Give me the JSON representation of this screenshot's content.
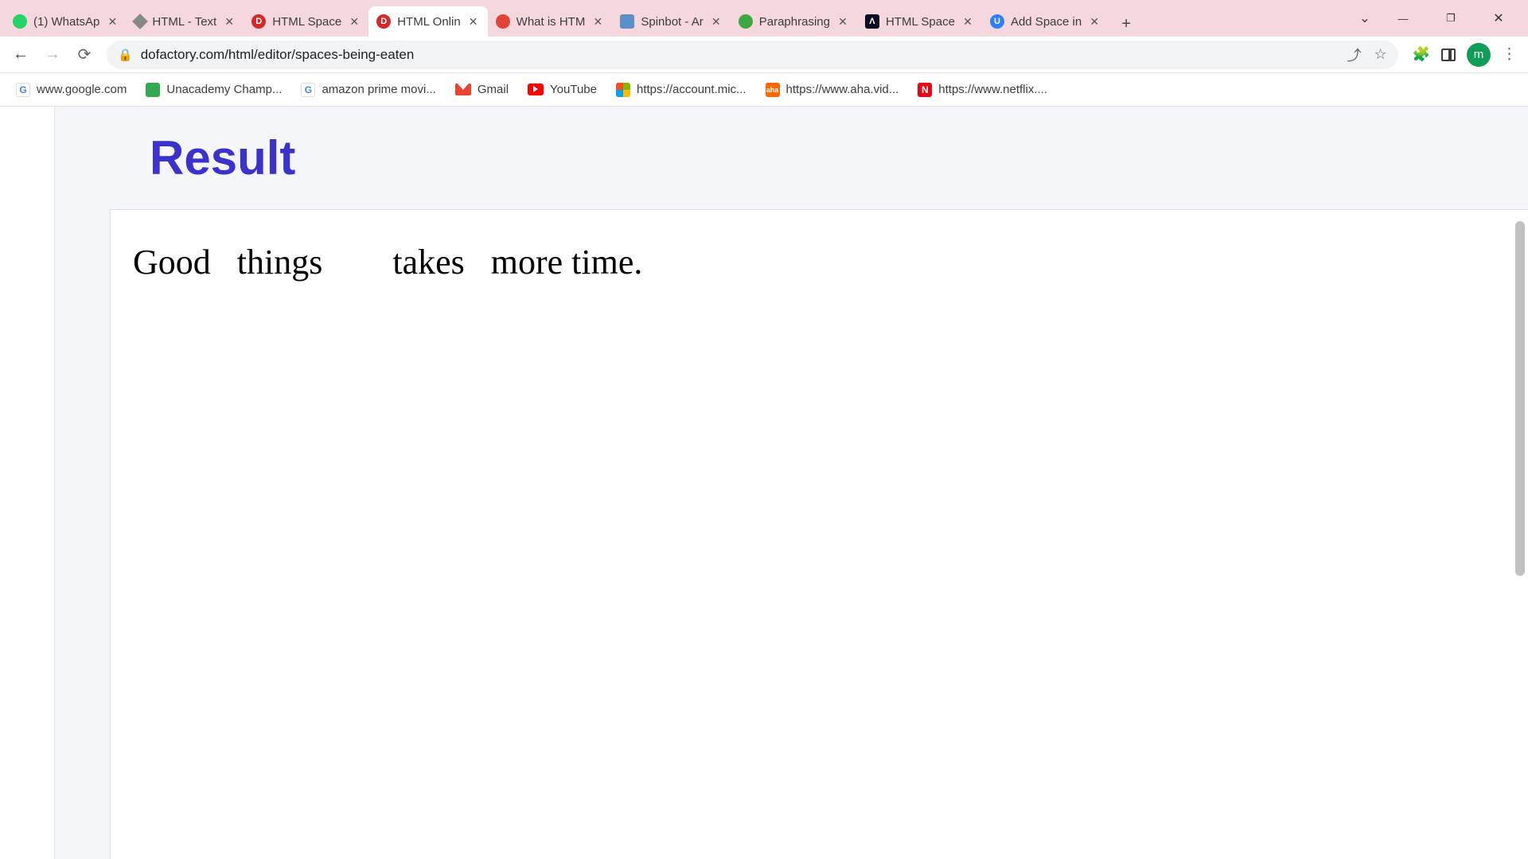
{
  "tabs": [
    {
      "title": "(1) WhatsAp",
      "favicon": "whatsapp",
      "active": false
    },
    {
      "title": "HTML - Text",
      "favicon": "diamond",
      "active": false
    },
    {
      "title": "HTML Space",
      "favicon": "dofactory",
      "active": false
    },
    {
      "title": "HTML Onlin",
      "favicon": "dofactory",
      "active": true
    },
    {
      "title": "What is HTM",
      "favicon": "opera",
      "active": false
    },
    {
      "title": "Spinbot - Ar",
      "favicon": "spinbot",
      "active": false
    },
    {
      "title": "Paraphrasing",
      "favicon": "paraph",
      "active": false
    },
    {
      "title": "HTML Space",
      "favicon": "freecode",
      "active": false
    },
    {
      "title": "Add Space in",
      "favicon": "unacademy",
      "active": false
    }
  ],
  "address": {
    "url": "dofactory.com/html/editor/spaces-being-eaten"
  },
  "profile": {
    "initial": "m"
  },
  "bookmarks": [
    {
      "label": "www.google.com",
      "icon": "google"
    },
    {
      "label": "Unacademy Champ...",
      "icon": "unacademy"
    },
    {
      "label": "amazon prime movi...",
      "icon": "amazon"
    },
    {
      "label": "Gmail",
      "icon": "gmail"
    },
    {
      "label": "YouTube",
      "icon": "youtube"
    },
    {
      "label": "https://account.mic...",
      "icon": "ms"
    },
    {
      "label": "https://www.aha.vid...",
      "icon": "aha"
    },
    {
      "label": "https://www.netflix....",
      "icon": "netflix"
    }
  ],
  "page": {
    "result_heading": "Result",
    "output_text": "Good   things        takes   more time."
  }
}
